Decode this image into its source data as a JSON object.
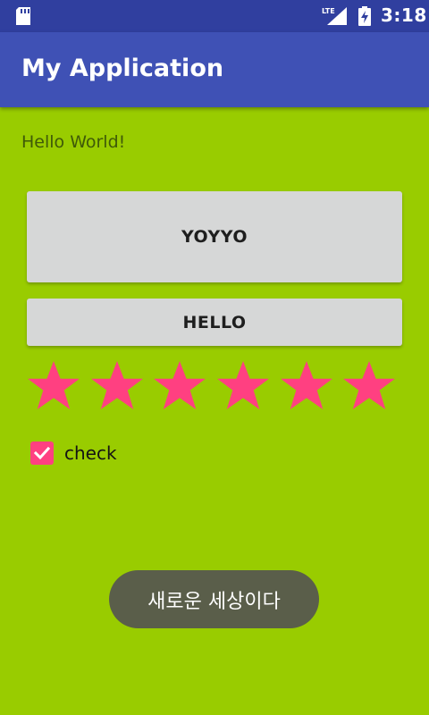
{
  "status_bar": {
    "time": "3:18",
    "network": "LTE",
    "icons": [
      "sd-card-icon",
      "lte-signal-icon",
      "battery-charging-icon"
    ]
  },
  "app_bar": {
    "title": "My Application",
    "color": "#3f51b5"
  },
  "main": {
    "background": "#99cc00",
    "hello_text": "Hello World!",
    "buttons": [
      {
        "label": "YOYYO"
      },
      {
        "label": "HELLO"
      }
    ],
    "rating": {
      "value": 6,
      "max": 6,
      "star_color": "#ff4081"
    },
    "checkbox": {
      "label": "check",
      "checked": true,
      "accent": "#ff4081"
    }
  },
  "toast": {
    "message": "새로운 세상이다"
  }
}
